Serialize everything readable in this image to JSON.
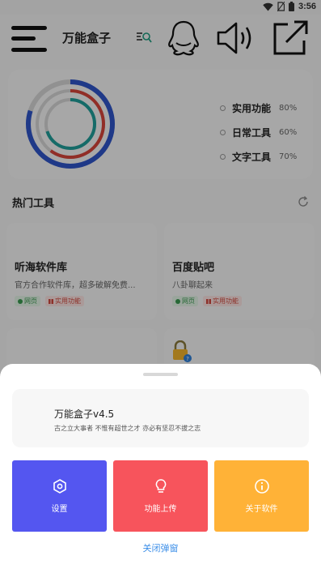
{
  "status_bar": {
    "time": "3:56",
    "icons": [
      "wifi-icon",
      "sim-off-icon",
      "battery-icon"
    ]
  },
  "app_bar": {
    "title": "万能盒子",
    "icons": [
      "menu-icon",
      "search-icon",
      "qq-icon",
      "volume-icon",
      "share-icon"
    ]
  },
  "stats": {
    "items": [
      {
        "name": "实用功能",
        "value": "80%",
        "fraction": 0.8,
        "color": "#2e55c9"
      },
      {
        "name": "日常工具",
        "value": "60%",
        "fraction": 0.6,
        "color": "#d6453a"
      },
      {
        "name": "文字工具",
        "value": "70%",
        "fraction": 0.7,
        "color": "#1f9e9a"
      }
    ]
  },
  "hot_tools": {
    "heading": "热门工具",
    "items": [
      {
        "name": "听海软件库",
        "desc": "官方合作软件库，超多破解免费...",
        "tags": [
          "网页",
          "实用功能"
        ]
      },
      {
        "name": "百度贴吧",
        "desc": "八卦聊起来",
        "tags": [
          "网页",
          "实用功能"
        ]
      }
    ]
  },
  "dialog": {
    "title": "万能盒子v4.5",
    "subtitle": "古之立大事者 不惟有超世之才 亦必有坚忍不拔之志",
    "actions": [
      {
        "label": "设置",
        "icon": "settings-icon",
        "color": "#5456f0"
      },
      {
        "label": "功能上传",
        "icon": "lightbulb-icon",
        "color": "#f7545c"
      },
      {
        "label": "关于软件",
        "icon": "info-icon",
        "color": "#ffb237"
      }
    ],
    "close_label": "关闭弹窗"
  }
}
